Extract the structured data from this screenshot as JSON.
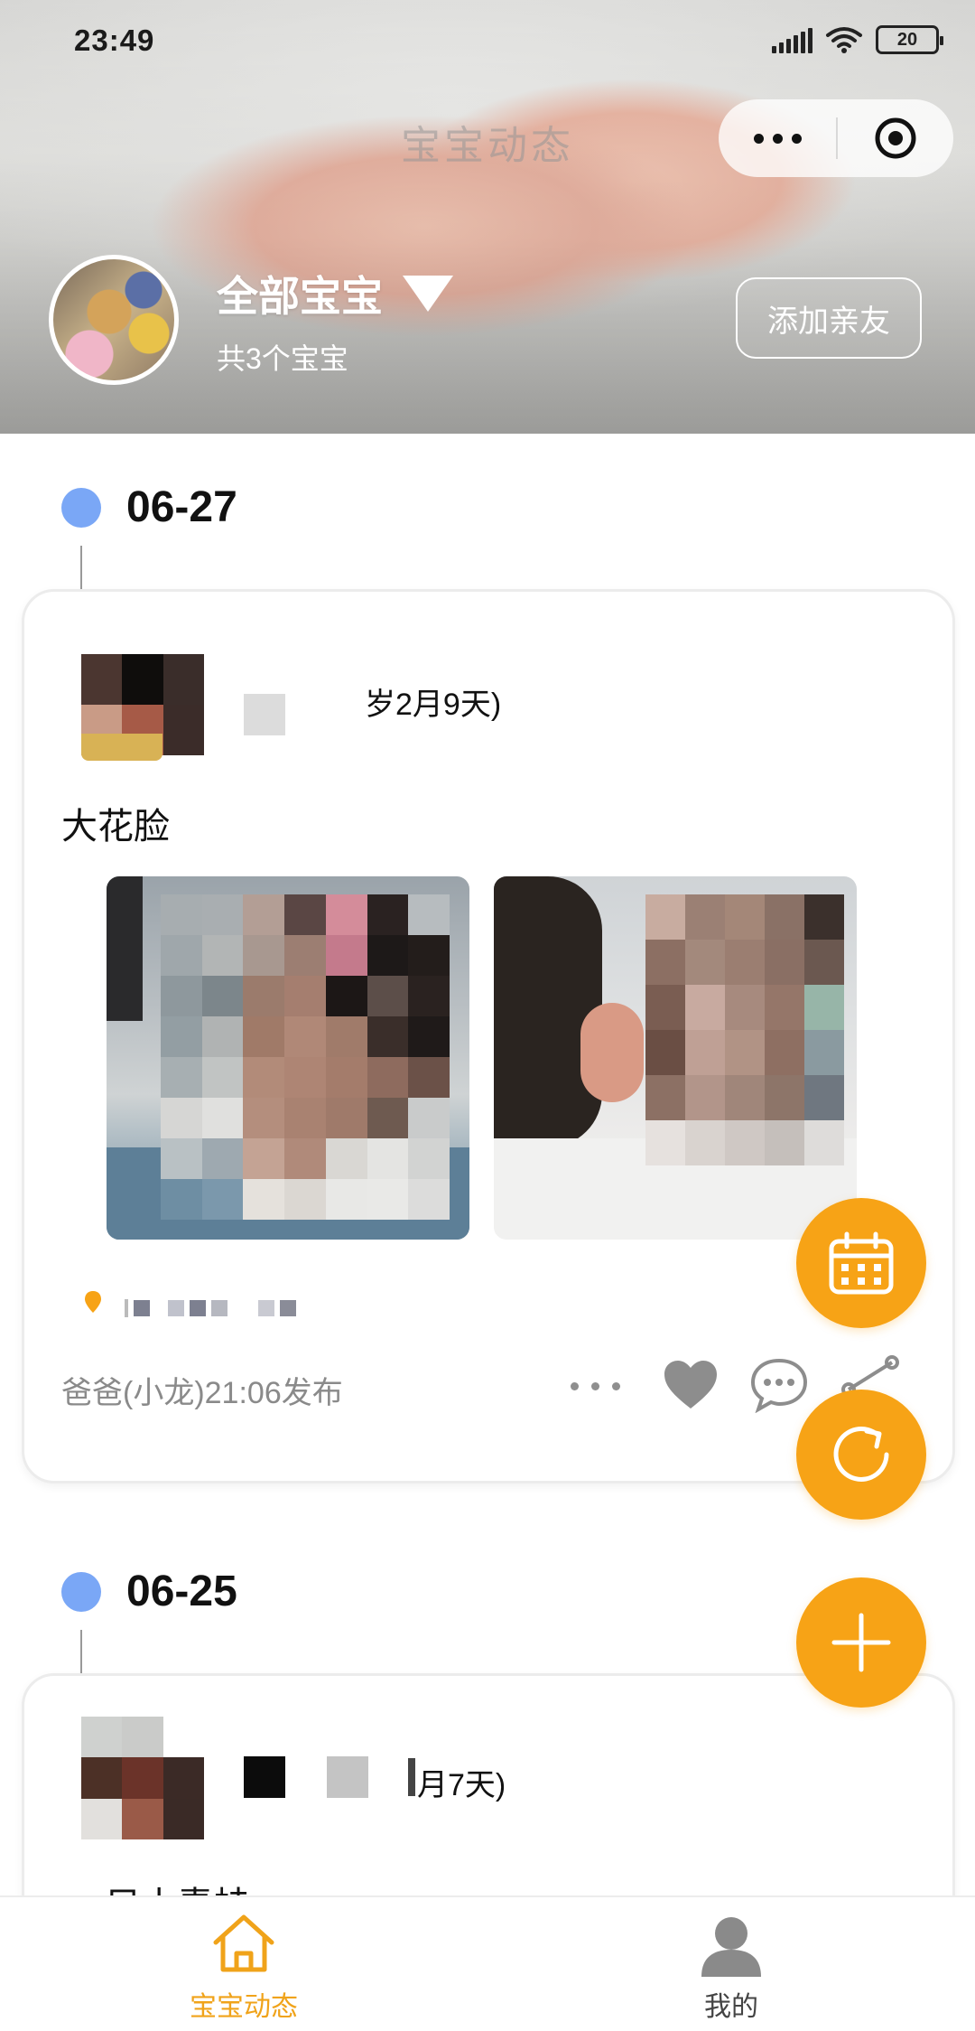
{
  "status_bar": {
    "time": "23:49",
    "battery": "20"
  },
  "header": {
    "title": "宝宝动态",
    "baby_selector": "全部宝宝",
    "baby_count": "共3个宝宝",
    "add_friend": "添加亲友"
  },
  "feed": [
    {
      "date": "06-27",
      "age_text": "岁2月9天)",
      "content": "大花脸",
      "footer": "爸爸(小龙)21:06发布"
    },
    {
      "date": "06-25",
      "age_text": "月7天)",
      "content": "只小青蛙"
    }
  ],
  "fabs": [
    "calendar-icon",
    "refresh-icon",
    "plus-icon"
  ],
  "bottom_nav": [
    {
      "label": "宝宝动态",
      "icon": "home-icon",
      "active": true
    },
    {
      "label": "我的",
      "icon": "person-icon",
      "active": false
    }
  ],
  "colors": {
    "accent": "#f7a316",
    "timeline_dot": "#7aa7f6",
    "active_nav": "#f0a31a"
  }
}
